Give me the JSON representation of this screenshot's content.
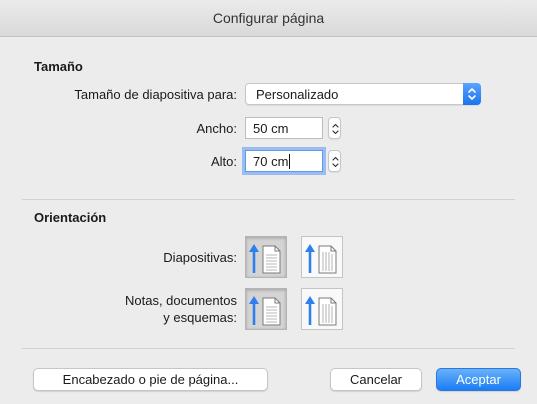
{
  "window": {
    "title": "Configurar página"
  },
  "size_section": {
    "title": "Tamaño",
    "slide_size_label": "Tamaño de diapositiva para:",
    "slide_size_value": "Personalizado",
    "width_label": "Ancho:",
    "width_value": "50 cm",
    "height_label": "Alto:",
    "height_value": "70 cm"
  },
  "orientation_section": {
    "title": "Orientación",
    "slides_label": "Diapositivas:",
    "slides_selected": "portrait",
    "notes_label_line1": "Notas, documentos",
    "notes_label_line2": "y esquemas:",
    "notes_selected": "portrait"
  },
  "footer": {
    "header_footer_button": "Encabezado o pie de página...",
    "cancel_button": "Cancelar",
    "accept_button": "Aceptar"
  },
  "icons": {
    "portrait": "portrait-orientation-icon",
    "landscape": "landscape-orientation-icon",
    "dropdown": "chevron-updown-icon",
    "stepper": "stepper-arrows-icon"
  },
  "colors": {
    "accent": "#1a7df5",
    "arrow_blue": "#2f80ed",
    "window_bg": "#ececec"
  }
}
